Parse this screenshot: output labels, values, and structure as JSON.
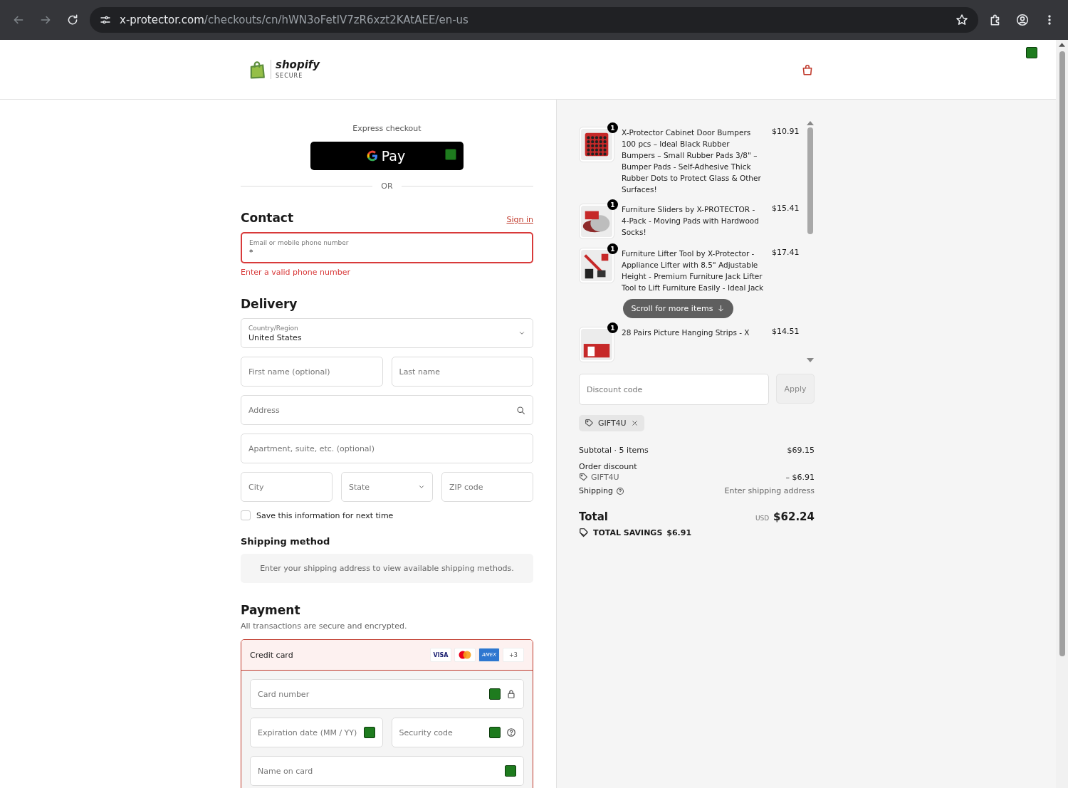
{
  "browser": {
    "url_host": "x-protector.com",
    "url_path": "/checkouts/cn/hWN3oFetlV7zR6xzt2KAtAEE/en-us"
  },
  "header": {
    "brand": "shopify",
    "brand_sub": "SECURE"
  },
  "express": {
    "label": "Express checkout",
    "gpay": "Pay",
    "divider": "OR"
  },
  "contact": {
    "title": "Contact",
    "sign_in": "Sign in",
    "field_label": "Email or mobile phone number",
    "field_value": "*",
    "error": "Enter a valid phone number"
  },
  "delivery": {
    "title": "Delivery",
    "country_label": "Country/Region",
    "country_value": "United States",
    "fields": [
      {
        "items": [
          {
            "kind": "text",
            "placeholder": "First name (optional)"
          },
          {
            "kind": "text",
            "placeholder": "Last name"
          }
        ]
      },
      {
        "items": [
          {
            "kind": "search",
            "placeholder": "Address"
          }
        ]
      },
      {
        "items": [
          {
            "kind": "text",
            "placeholder": "Apartment, suite, etc. (optional)"
          }
        ]
      },
      {
        "items": [
          {
            "kind": "text",
            "placeholder": "City"
          },
          {
            "kind": "select",
            "placeholder": "State"
          },
          {
            "kind": "text",
            "placeholder": "ZIP code"
          }
        ]
      }
    ],
    "save": {
      "label": "Save this information for next time",
      "checked": false
    }
  },
  "shipping_method": {
    "title": "Shipping method",
    "note": "Enter your shipping address to view available shipping methods."
  },
  "payment": {
    "title": "Payment",
    "subtitle": "All transactions are secure and encrypted.",
    "method": "Credit card",
    "selected": true,
    "cards": [
      {
        "kind": "visa",
        "label": "VISA"
      },
      {
        "kind": "mastercard"
      },
      {
        "kind": "amex",
        "label": "AMEX"
      },
      {
        "kind": "more",
        "label": "+3"
      }
    ],
    "fields": [
      {
        "items": [
          {
            "kind": "lock",
            "placeholder": "Card number"
          }
        ]
      },
      {
        "items": [
          {
            "kind": "plain",
            "placeholder": "Expiration date (MM / YY)"
          },
          {
            "kind": "help",
            "placeholder": "Security code"
          }
        ]
      },
      {
        "items": [
          {
            "kind": "plain",
            "placeholder": "Name on card"
          }
        ]
      }
    ]
  },
  "cart": {
    "items": [
      {
        "kind": "bumpers",
        "quantity": "1",
        "title": "X-Protector Cabinet Door Bumpers 100 pcs – Ideal Black Rubber Bumpers – Small Rubber Pads 3/8\" – Bumper Pads - Self-Adhesive Thick Rubber Dots to Protect Glass & Other Surfaces!",
        "price": "$10.91"
      },
      {
        "kind": "sliders",
        "quantity": "1",
        "title": "Furniture Sliders by X-PROTECTOR - 4-Pack - Moving Pads with Hardwood Socks!",
        "price": "$15.41"
      },
      {
        "kind": "lifter",
        "quantity": "1",
        "title": "Furniture Lifter Tool by X-Protector - Appliance Lifter with 8.5\" Adjustable Height - Premium Furniture Jack Lifter Tool to Lift Furniture Easily - Ideal Jack",
        "price": "$17.41"
      },
      {
        "kind": "strips",
        "quantity": "1",
        "title": "28 Pairs Picture Hanging Strips - X",
        "price": "$14.51"
      }
    ],
    "scroll_hint": "Scroll for more items",
    "discount_placeholder": "Discount code",
    "apply": "Apply",
    "applied_code": "GIFT4U",
    "subtotal_label": "Subtotal · 5 items",
    "subtotal": "$69.15",
    "discount_label": "Order discount",
    "discount_code": "GIFT4U",
    "discount": "– $6.91",
    "shipping_label": "Shipping",
    "shipping_value": "Enter shipping address",
    "total_label": "Total",
    "currency": "USD",
    "total": "$62.24",
    "savings_label": "TOTAL SAVINGS",
    "savings": "$6.91"
  }
}
